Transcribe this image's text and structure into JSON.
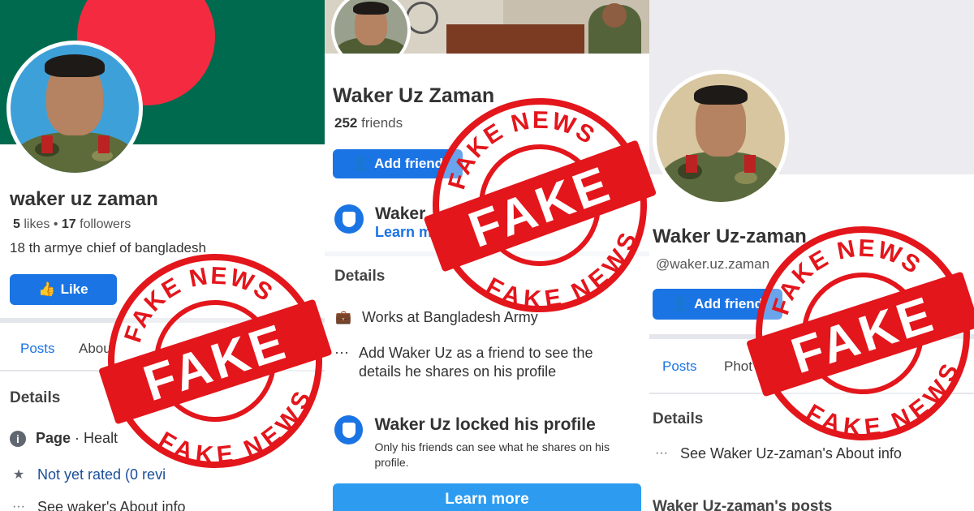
{
  "panel1": {
    "name": "waker uz zaman",
    "likes_count": "5",
    "likes_label": "likes",
    "followers_count": "17",
    "followers_label": "followers",
    "bio": "18 th armye chief of bangladesh",
    "like_button": "Like",
    "tabs": [
      "Posts",
      "About"
    ],
    "details_heading": "Details",
    "page_label": "Page",
    "page_category": "· Healt",
    "rating": "Not yet rated (0 revi",
    "about_link": "See waker's About info"
  },
  "panel2": {
    "name": "Waker Uz Zaman",
    "friends_count": "252",
    "friends_label": "friends",
    "add_friend": "Add friend",
    "locked_short": "Waker",
    "learn_more_short": "Learn m",
    "details_heading": "Details",
    "works_at": "Works at Bangladesh Army",
    "add_note": "Add Waker Uz as a friend to see the details he shares on his profile",
    "locked_title": "Waker Uz locked his profile",
    "locked_desc": "Only his friends can see what he shares on his profile.",
    "learn_more_button": "Learn more"
  },
  "panel3": {
    "name": "Waker Uz-zaman",
    "handle": "@waker.uz.zaman",
    "add_friend": "Add friend",
    "tabs": [
      "Posts",
      "Phot"
    ],
    "details_heading": "Details",
    "about_link": "See Waker Uz-zaman's About info",
    "posts_heading": "Waker Uz-zaman's posts"
  },
  "stamp": {
    "center_text": "FAKE",
    "ring_text": "FAKE NEWS",
    "color": "#e3161c"
  },
  "colors": {
    "facebook_blue": "#1b74e4",
    "flag_green": "#006a4e",
    "flag_red": "#f42a41"
  }
}
